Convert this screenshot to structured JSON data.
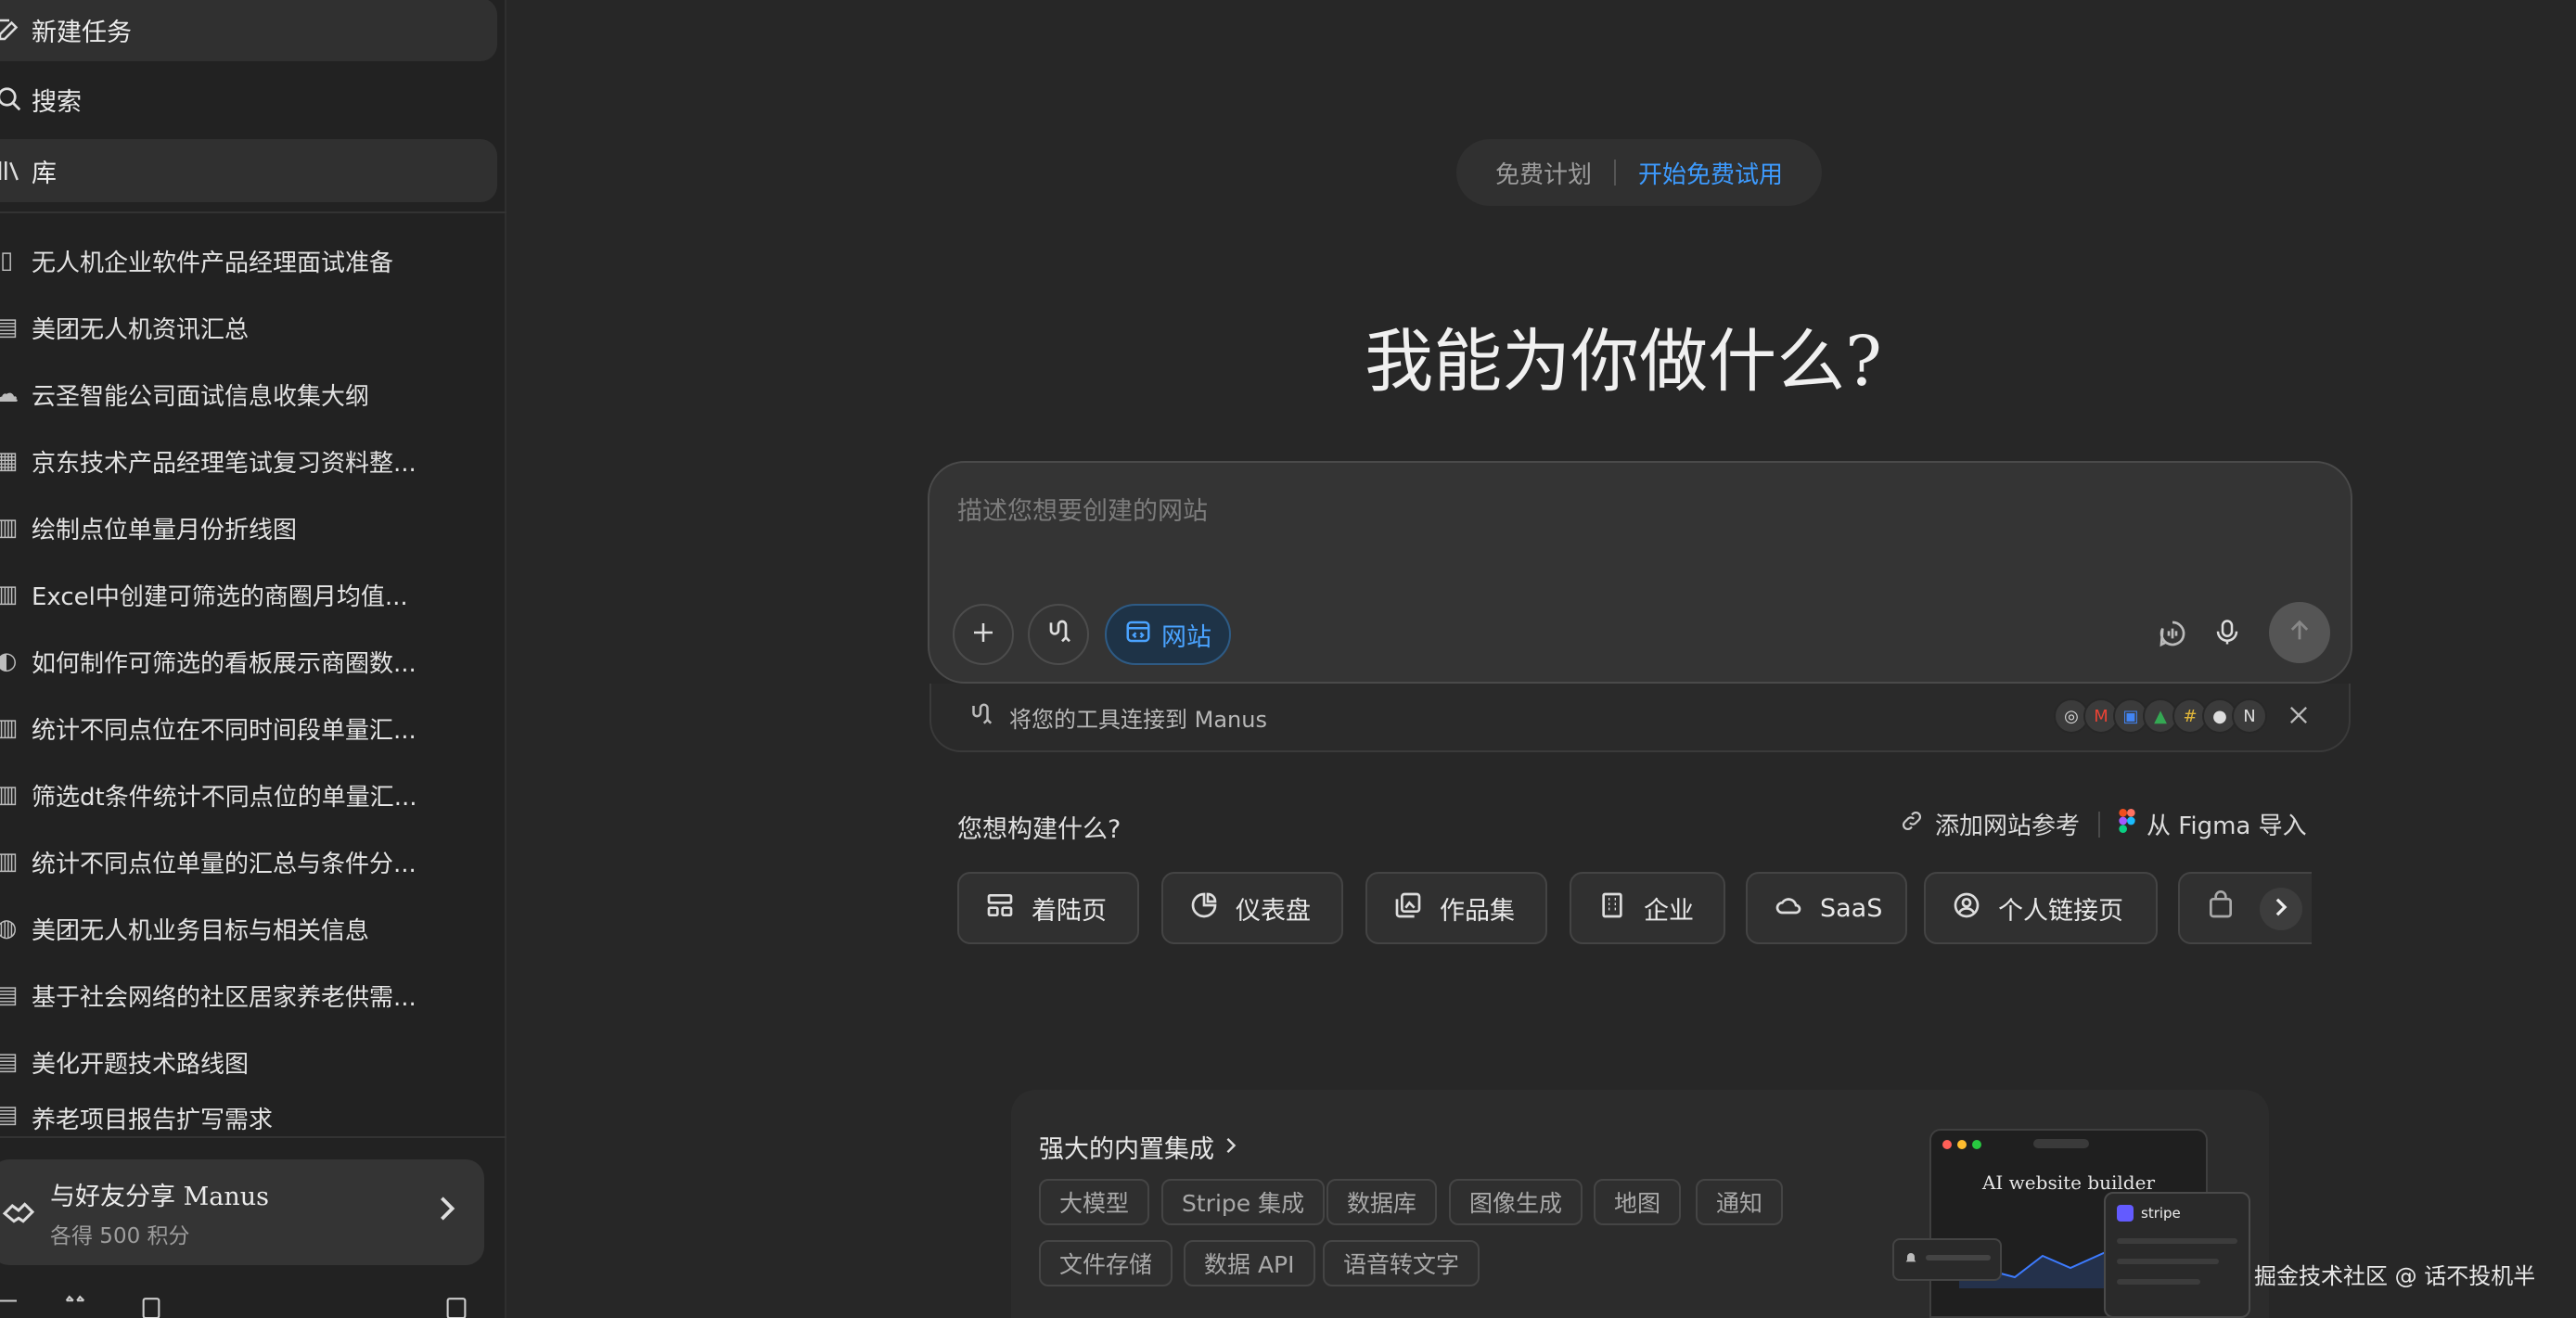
{
  "sidebar": {
    "nav": {
      "new_task": "新建任务",
      "search": "搜索",
      "library": "库"
    },
    "tasks": [
      {
        "label": "无人机企业软件产品经理面试准备"
      },
      {
        "label": "美团无人机资讯汇总"
      },
      {
        "label": "云圣智能公司面试信息收集大纲"
      },
      {
        "label": "京东技术产品经理笔试复习资料整..."
      },
      {
        "label": "绘制点位单量月份折线图"
      },
      {
        "label": "Excel中创建可筛选的商圈月均值..."
      },
      {
        "label": "如何制作可筛选的看板展示商圈数..."
      },
      {
        "label": "统计不同点位在不同时间段单量汇..."
      },
      {
        "label": "筛选dt条件统计不同点位的单量汇..."
      },
      {
        "label": "统计不同点位单量的汇总与条件分..."
      },
      {
        "label": "美团无人机业务目标与相关信息"
      },
      {
        "label": "基于社会网络的社区居家养老供需..."
      },
      {
        "label": "美化开题技术路线图"
      },
      {
        "label": "养老项目报告扩写需求"
      }
    ],
    "share": {
      "title": "与好友分享 Manus",
      "subtitle": "各得 500 积分"
    }
  },
  "plan": {
    "free_label": "免费计划",
    "trial_label": "开始免费试用"
  },
  "hero_title": "我能为你做什么?",
  "composer": {
    "placeholder": "描述您想要创建的网站",
    "mode_chip": "网站"
  },
  "connect": {
    "label": "将您的工具连接到 Manus",
    "tools": [
      "chrome-icon",
      "gmail-icon",
      "outlook-icon",
      "google-drive-icon",
      "slack-icon",
      "github-icon",
      "notion-icon"
    ]
  },
  "build": {
    "title": "您想构建什么?",
    "add_reference": "添加网站参考",
    "figma_import": "从 Figma 导入",
    "categories": [
      {
        "label": "着陆页",
        "icon": "layout-icon"
      },
      {
        "label": "仪表盘",
        "icon": "pie-chart-icon"
      },
      {
        "label": "作品集",
        "icon": "gallery-icon"
      },
      {
        "label": "企业",
        "icon": "building-icon"
      },
      {
        "label": "SaaS",
        "icon": "cloud-icon"
      },
      {
        "label": "个人链接页",
        "icon": "user-circle-icon"
      },
      {
        "label": "",
        "icon": "shopping-bag-icon"
      }
    ]
  },
  "integrations": {
    "title": "强大的内置集成",
    "tags_row1": [
      "大模型",
      "Stripe 集成",
      "数据库",
      "图像生成",
      "地图",
      "通知"
    ],
    "tags_row2": [
      "文件存储",
      "数据 API",
      "语音转文字"
    ],
    "preview_title": "AI website builder",
    "stripe_label": "stripe"
  },
  "watermark": "掘金技术社区 @ 话不投机半",
  "colors": {
    "background": "#272727",
    "sidebar": "#222222",
    "accent": "#3d9bff"
  }
}
